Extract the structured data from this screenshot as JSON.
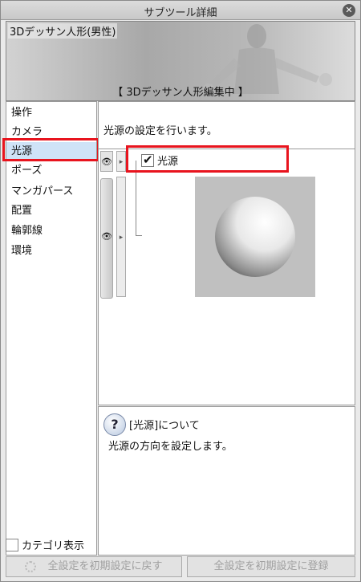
{
  "window": {
    "title": "サブツール詳細",
    "close_icon": "close-icon"
  },
  "banner": {
    "model_name": "3Dデッサン人形(男性)",
    "mode": "【 3Dデッサン人形編集中 】"
  },
  "categories": [
    {
      "label": "操作"
    },
    {
      "label": "カメラ"
    },
    {
      "label": "光源"
    },
    {
      "label": "ポーズ"
    },
    {
      "label": "マンガパース"
    },
    {
      "label": "配置"
    },
    {
      "label": "輪郭線"
    },
    {
      "label": "環境"
    }
  ],
  "selected_category": "光源",
  "category_display": {
    "label": "カテゴリ表示",
    "checked": false
  },
  "main": {
    "description": "光源の設定を行います。",
    "light": {
      "label": "光源",
      "checked": true
    }
  },
  "info": {
    "icon": "question-icon",
    "title": "[光源]について",
    "description": "光源の方向を設定します。"
  },
  "buttons": {
    "reset_all": "全設定を初期設定に戻す",
    "register_all": "全設定を初期設定に登録"
  },
  "colors": {
    "selected_bg": "#cfe3f7",
    "highlight_red": "#e8141e"
  }
}
